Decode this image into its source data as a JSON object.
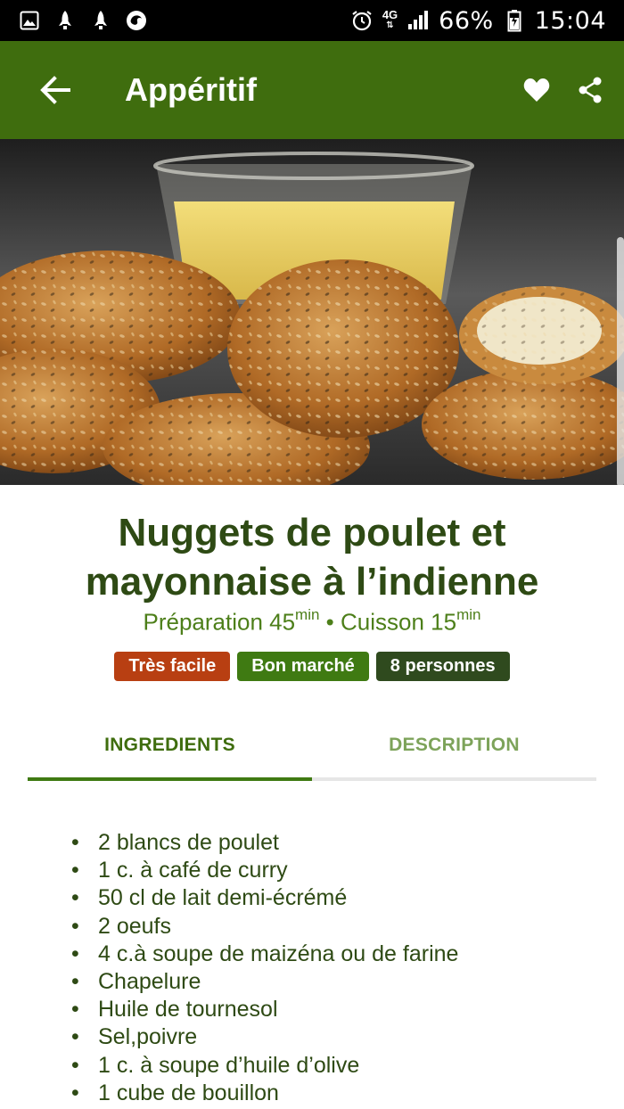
{
  "status_bar": {
    "network": "4G",
    "battery": "66%",
    "time": "15:04"
  },
  "app_bar": {
    "title": "Appéritif"
  },
  "recipe": {
    "title_line1": "Nuggets de poulet et",
    "title_line2": "mayonnaise à l’indienne",
    "prep_label": "Préparation 45",
    "prep_unit": "min",
    "separator": " • ",
    "cook_label": "Cuisson 15",
    "cook_unit": "min"
  },
  "badges": {
    "difficulty": "Très facile",
    "cost": "Bon marché",
    "servings": "8 personnes"
  },
  "tabs": {
    "ingredients": "INGREDIENTS",
    "description": "DESCRIPTION",
    "active": "ingredients"
  },
  "ingredients": [
    "2 blancs de poulet",
    "1 c. à café de curry",
    "50 cl de lait demi-écrémé",
    "2 oeufs",
    "4 c.à soupe de maizéna ou de farine",
    "Chapelure",
    "Huile de tournesol",
    "Sel,poivre",
    "1 c. à soupe d’huile d’olive",
    "1 cube de bouillon"
  ],
  "colors": {
    "app_bar": "#3f6d0e",
    "title": "#2e4a14",
    "badge_difficulty": "#b83f12",
    "badge_cost": "#3f7a12",
    "badge_servings": "#2f4a1e"
  },
  "icons": {
    "status_left": [
      "gallery-icon",
      "rocket-icon",
      "rocket-icon",
      "firefox-icon"
    ],
    "status_right": [
      "alarm-icon",
      "signal-icon",
      "battery-icon"
    ],
    "app_bar": [
      "back-arrow-icon",
      "heart-icon",
      "share-icon"
    ]
  }
}
